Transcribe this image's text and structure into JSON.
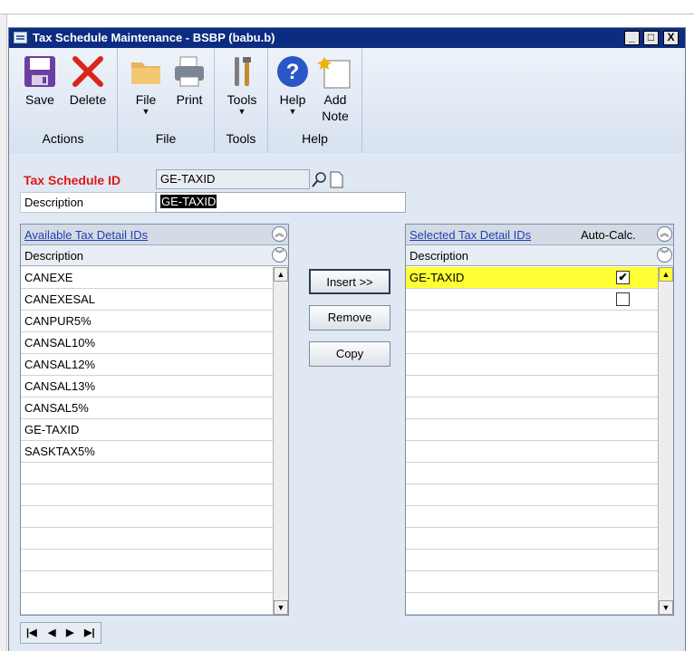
{
  "window": {
    "title": "Tax Schedule Maintenance  -  BSBP (babu.b)",
    "min": "_",
    "max": "□",
    "close": "X"
  },
  "ribbon": {
    "groups": [
      {
        "name": "Actions",
        "buttons": [
          "Save",
          "Delete"
        ]
      },
      {
        "name": "File",
        "buttons": [
          "File",
          "Print"
        ]
      },
      {
        "name": "Tools",
        "buttons": [
          "Tools"
        ]
      },
      {
        "name": "Help",
        "buttons": [
          "Help",
          "Add Note"
        ]
      }
    ],
    "add_note_line1": "Add",
    "add_note_line2": "Note"
  },
  "form": {
    "tax_schedule_label": "Tax Schedule ID",
    "tax_schedule_value": "GE-TAXID",
    "description_label": "Description",
    "description_value": "GE-TAXID"
  },
  "available": {
    "title": "Available Tax Detail IDs",
    "column": "Description",
    "rows": [
      "CANEXE",
      "CANEXESAL",
      "CANPUR5%",
      "CANSAL10%",
      "CANSAL12%",
      "CANSAL13%",
      "CANSAL5%",
      "GE-TAXID",
      "SASKTAX5%",
      "",
      "",
      "",
      "",
      "",
      "",
      ""
    ]
  },
  "selected": {
    "title": "Selected Tax Detail IDs",
    "autocalc": "Auto-Calc.",
    "column": "Description",
    "rows": [
      {
        "desc": "GE-TAXID",
        "checked": true,
        "highlight": true
      },
      {
        "desc": "",
        "checked": false,
        "highlight": false
      }
    ],
    "highlight_color": "#ffff33"
  },
  "buttons": {
    "insert": "Insert >>",
    "remove": "Remove",
    "copy": "Copy"
  },
  "nav": {
    "first": "|◀",
    "prev": "◀",
    "next": "▶",
    "last": "▶|"
  }
}
